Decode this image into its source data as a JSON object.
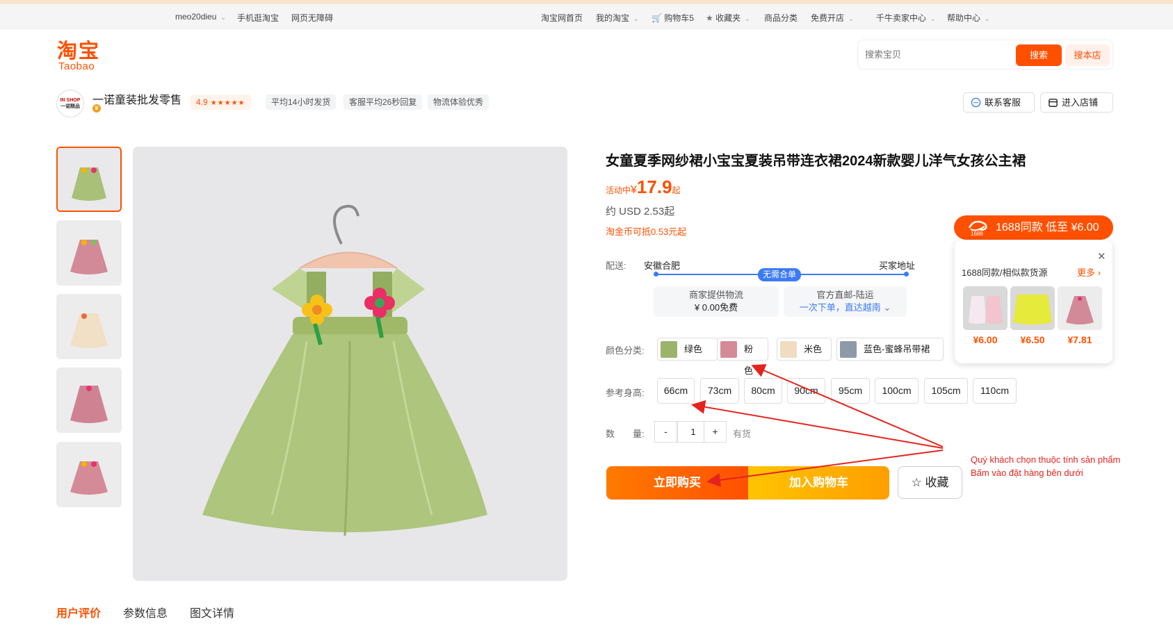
{
  "topbar": {
    "user": "meo20dieu",
    "mobile": "手机逛淘宝",
    "accessible": "网页无障碍",
    "home": "淘宝网首页",
    "my_taobao": "我的淘宝",
    "cart": "购物车5",
    "favorites": "收藏夹",
    "categories": "商品分类",
    "open_store": "免费开店",
    "seller_center": "千牛卖家中心",
    "help": "帮助中心"
  },
  "logo": {
    "cn": "淘宝",
    "en": "Taobao"
  },
  "search": {
    "placeholder": "搜索宝贝",
    "search_btn": "搜索",
    "store_btn": "搜本店"
  },
  "shop": {
    "logo_line1": "IN SHOP",
    "logo_line2": "一诺精品",
    "name": "一诺童装批发零售",
    "rating": "4.9",
    "stars": "★★★★★",
    "tags": [
      "平均14小时发货",
      "客服平均26秒回复",
      "物流体验优秀"
    ],
    "contact_btn": "联系客服",
    "enter_btn": "进入店铺"
  },
  "product": {
    "title": "女童夏季网纱裙小宝宝夏装吊带连衣裙2024新款婴儿洋气女孩公主裙",
    "price_label": "活动中",
    "currency": "¥",
    "price": "17.9",
    "price_suffix": "起",
    "usd": "约 USD 2.53起",
    "coin": "淘金币可抵0.53元起"
  },
  "shipping": {
    "label": "配送:",
    "from": "安徽合肥",
    "to": "买家地址",
    "badge": "无需合单",
    "card1_title": "商家提供物流",
    "card1_value": "¥ 0.00免费",
    "card2_title": "官方直邮-陆运",
    "card2_value": "一次下单，直达越南"
  },
  "colors": {
    "label": "颜色分类:",
    "options": [
      "绿色",
      "粉色",
      "米色",
      "蓝色-蜜蜂吊带裙"
    ],
    "swatches": [
      "#9cb36a",
      "#d58a98",
      "#f0dcc0",
      "#8e9aa8"
    ]
  },
  "sizes": {
    "label": "参考身高:",
    "options": [
      "66cm",
      "73cm",
      "80cm",
      "90cm",
      "95cm",
      "100cm",
      "105cm",
      "110cm"
    ]
  },
  "quantity": {
    "label": "数　　量:",
    "minus": "-",
    "value": "1",
    "plus": "+",
    "stock": "有货"
  },
  "actions": {
    "buy": "立即购买",
    "cart": "加入购物车",
    "favorite": "收藏"
  },
  "similar": {
    "tag_logo": "1688",
    "tag_text": "1688同款  低至 ¥6.00",
    "header": "1688同款/相似款货源",
    "more": "更多",
    "prices": [
      "¥6.00",
      "¥6.50",
      "¥7.81"
    ]
  },
  "annotation": {
    "line1": "Quý khách chọn thuộc tính sản phẩm",
    "line2": "Bấm vào đặt hàng bên dưới"
  },
  "tabs": [
    "用户评价",
    "参数信息",
    "图文详情"
  ],
  "colors_theme": {
    "accent": "#ff5000",
    "blue": "#3b7bf6",
    "annotation_red": "#e5231d"
  }
}
